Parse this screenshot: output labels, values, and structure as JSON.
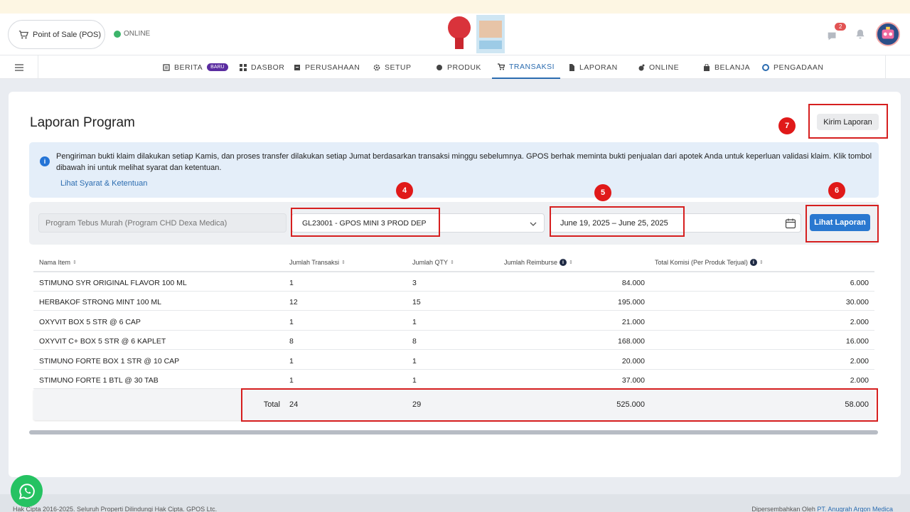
{
  "header": {
    "pos_label": "Point of Sale (POS)",
    "status": "ONLINE",
    "chat_count": "2",
    "status_color": "#3cb46a"
  },
  "nav": {
    "items": [
      {
        "label": "BERITA",
        "badge": "BARU",
        "icon": "news-icon"
      },
      {
        "label": "DASBOR",
        "icon": "dashboard-icon"
      },
      {
        "label": "PERUSAHAAN",
        "icon": "company-icon"
      },
      {
        "label": "SETUP",
        "icon": "gear-icon"
      },
      {
        "label": "PRODUK",
        "icon": "product-icon"
      },
      {
        "label": "TRANSAKSI",
        "icon": "cart-icon",
        "active": true
      },
      {
        "label": "LAPORAN",
        "icon": "report-icon"
      },
      {
        "label": "ONLINE",
        "icon": "online-icon"
      },
      {
        "label": "BELANJA",
        "icon": "shopping-bag-icon"
      },
      {
        "label": "PENGADAAN",
        "icon": "procurement-icon"
      }
    ]
  },
  "page": {
    "title": "Laporan Program",
    "kirim_label": "Kirim Laporan"
  },
  "info": {
    "text": "Pengiriman bukti klaim dilakukan setiap Kamis, dan proses transfer dilakukan setiap Jumat berdasarkan transaksi minggu sebelumnya. GPOS berhak meminta bukti penjualan dari apotek Anda untuk keperluan validasi klaim. Klik tombol dibawah ini untuk melihat syarat dan ketentuan.",
    "link": "Lihat Syarat & Ketentuan"
  },
  "filters": {
    "program_placeholder": "Program Tebus Murah (Program CHD Dexa Medica)",
    "code_value": "GL23001 - GPOS MINI 3 PROD DEP",
    "date_range": "June 19, 2025 – June 25, 2025",
    "lihat_label": "Lihat Laporan"
  },
  "markers": {
    "m4": "4",
    "m5": "5",
    "m6": "6",
    "m7": "7"
  },
  "table": {
    "headers": {
      "name": "Nama Item",
      "trx": "Jumlah Transaksi",
      "qty": "Jumlah QTY",
      "reimb": "Jumlah Reimburse",
      "kom": "Total Komisi (Per Produk Terjual)"
    },
    "rows": [
      {
        "name": "STIMUNO SYR ORIGINAL FLAVOR 100 ML",
        "trx": "1",
        "qty": "3",
        "reimb": "84.000",
        "kom": "6.000"
      },
      {
        "name": "HERBAKOF STRONG MINT 100 ML",
        "trx": "12",
        "qty": "15",
        "reimb": "195.000",
        "kom": "30.000"
      },
      {
        "name": "OXYVIT BOX 5 STR @ 6 CAP",
        "trx": "1",
        "qty": "1",
        "reimb": "21.000",
        "kom": "2.000"
      },
      {
        "name": "OXYVIT C+ BOX 5 STR @ 6 KAPLET",
        "trx": "8",
        "qty": "8",
        "reimb": "168.000",
        "kom": "16.000"
      },
      {
        "name": "STIMUNO FORTE BOX 1 STR @ 10 CAP",
        "trx": "1",
        "qty": "1",
        "reimb": "20.000",
        "kom": "2.000"
      },
      {
        "name": "STIMUNO FORTE 1 BTL @ 30 TAB",
        "trx": "1",
        "qty": "1",
        "reimb": "37.000",
        "kom": "2.000"
      }
    ],
    "total": {
      "label": "Total",
      "trx": "24",
      "qty": "29",
      "reimb": "525.000",
      "kom": "58.000"
    }
  },
  "footer": {
    "left": "Hak Cipta 2016-2025. Seluruh Properti Dilindungi Hak Cipta. GPOS Ltc.",
    "right_prefix": "Dipersembahkan Oleh ",
    "right_brand": "PT. Anugrah Argon Medica"
  }
}
